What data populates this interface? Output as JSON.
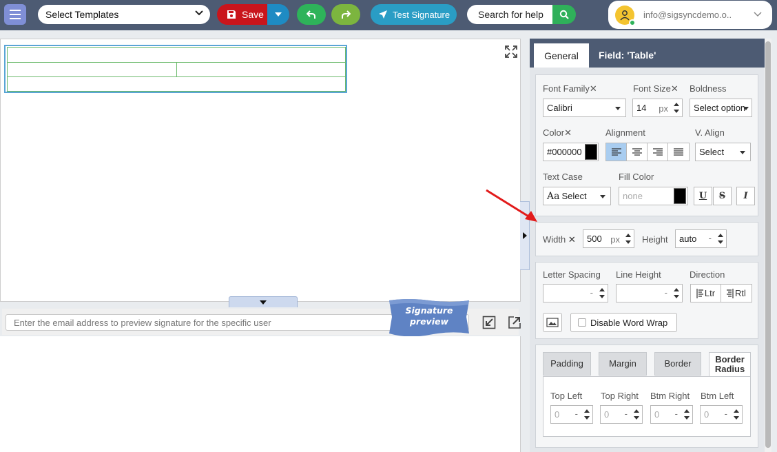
{
  "topbar": {
    "template_select": "Select Templates",
    "save_label": "Save",
    "test_label": "Test Signature",
    "help_placeholder": "Search for help",
    "user_email": "info@sigsyncdemo.o.."
  },
  "preview": {
    "placeholder": "Enter the email address to preview signature for the specific user",
    "ribbon_line1": "Signature",
    "ribbon_line2": "preview"
  },
  "panel": {
    "tab_general": "General",
    "field_prefix": "Field: ",
    "field_name": "'Table'",
    "font_family_label": "Font Family",
    "font_family_value": "Calibri",
    "font_size_label": "Font Size",
    "font_size_value": "14",
    "font_size_unit": "px",
    "boldness_label": "Boldness",
    "boldness_value": "Select option",
    "color_label": "Color",
    "color_value": "#000000",
    "alignment_label": "Alignment",
    "valign_label": "V. Align",
    "valign_value": "Select",
    "text_case_label": "Text Case",
    "text_case_prefix": "Aa",
    "text_case_value": "Select",
    "fill_color_label": "Fill Color",
    "fill_color_placeholder": "none",
    "underline_label": "U",
    "strike_label": "S",
    "italic_label": "I",
    "width_label": "Width",
    "width_value": "500",
    "width_unit": "px",
    "height_label": "Height",
    "height_value": "auto",
    "letter_spacing_label": "Letter Spacing",
    "line_height_label": "Line Height",
    "direction_label": "Direction",
    "ltr_label": "Ltr",
    "rtl_label": "Rtl",
    "disable_wrap_label": "Disable Word Wrap",
    "clear_x": "✕",
    "dash": "-",
    "sub_tabs": {
      "padding": "Padding",
      "margin": "Margin",
      "border": "Border",
      "border_radius_1": "Border",
      "border_radius_2": "Radius"
    },
    "radius": {
      "top_left": "Top Left",
      "top_right": "Top Right",
      "btm_right": "Btm Right",
      "btm_left": "Btm Left",
      "zero": "0"
    }
  },
  "colors": {
    "topbar": "#4d5b73",
    "save": "#c9151c",
    "save_dropdown": "#1e8bc3",
    "undo": "#2eb35a",
    "redo": "#7cb53f",
    "test": "#2a9dc5",
    "help_search": "#2fb05a",
    "avatar": "#f4c430",
    "annotation_arrow": "#e21b1b"
  }
}
